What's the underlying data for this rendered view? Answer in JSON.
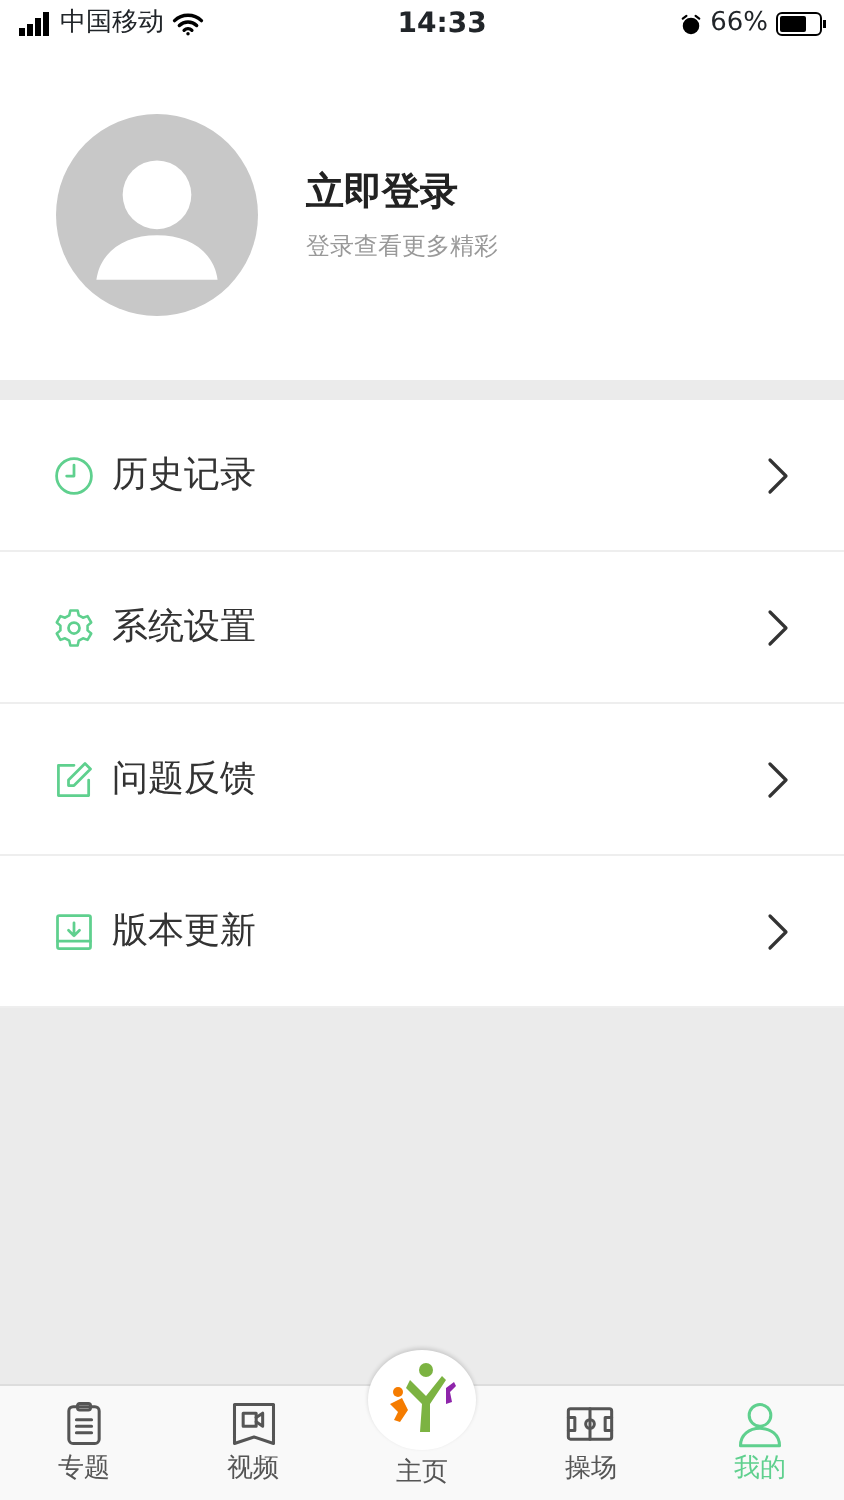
{
  "status_bar": {
    "carrier": "中国移动",
    "time": "14:33",
    "battery": "66%"
  },
  "profile": {
    "title": "立即登录",
    "subtitle": "登录查看更多精彩"
  },
  "menu": [
    {
      "kind": "clock",
      "label": "历史记录"
    },
    {
      "kind": "gear",
      "label": "系统设置"
    },
    {
      "kind": "edit",
      "label": "问题反馈"
    },
    {
      "kind": "download",
      "label": "版本更新"
    }
  ],
  "tabs": [
    {
      "kind": "clipboard",
      "label": "专题",
      "selected": false
    },
    {
      "kind": "video",
      "label": "视频",
      "selected": false
    },
    {
      "kind": "home",
      "label": "主页",
      "selected": false
    },
    {
      "kind": "field",
      "label": "操场",
      "selected": false
    },
    {
      "kind": "person",
      "label": "我的",
      "selected": true
    }
  ]
}
